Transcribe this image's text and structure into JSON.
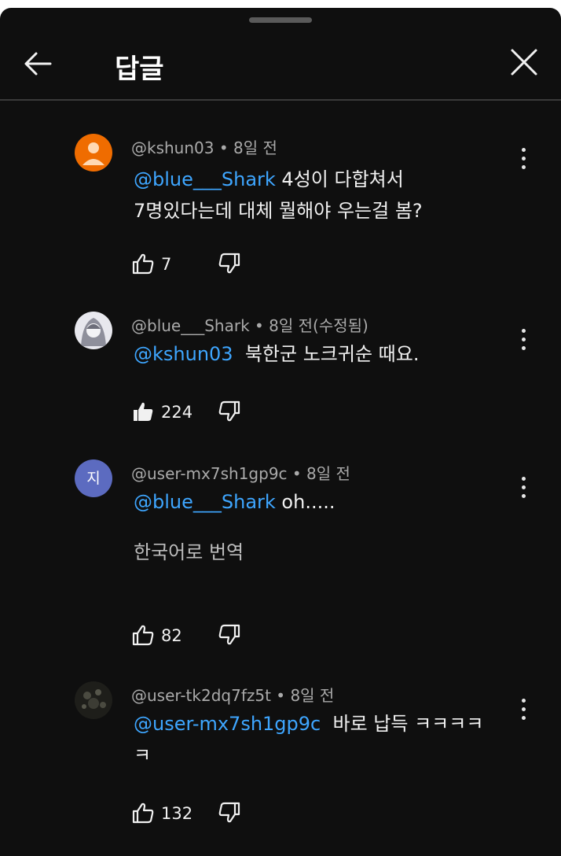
{
  "header": {
    "title": "답글"
  },
  "comments": [
    {
      "meta": "@kshun03 • 8일 전",
      "mention": "@blue___Shark",
      "text_line1": " 4성이 다합쳐서",
      "text_line2": "7명있다는데 대체 뭘해야 우는걸 봄?",
      "likes": "7",
      "liked": false
    },
    {
      "meta": "@blue___Shark • 8일 전(수정됨)",
      "mention": "@kshun03",
      "text_line1": "  북한군 노크귀순 때요.",
      "likes": "224",
      "liked": true
    },
    {
      "meta": "@user-mx7sh1gp9c • 8일 전",
      "avatar_letter": "지",
      "mention": "@blue___Shark",
      "text_line1": " oh.....",
      "translate": "한국어로 번역",
      "likes": "82",
      "liked": false
    },
    {
      "meta": "@user-tk2dq7fz5t • 8일 전",
      "mention": "@user-mx7sh1gp9c",
      "text_line1": "  바로 납득 ㅋㅋㅋㅋ",
      "text_line2": "ㅋ",
      "likes": "132",
      "liked": false
    }
  ],
  "colors": {
    "background": "#0f0f0f",
    "mention": "#3ea6ff",
    "meta": "#aaaaaa",
    "avatar_orange": "#ef6c00",
    "avatar_purple": "#5c6bc0"
  }
}
